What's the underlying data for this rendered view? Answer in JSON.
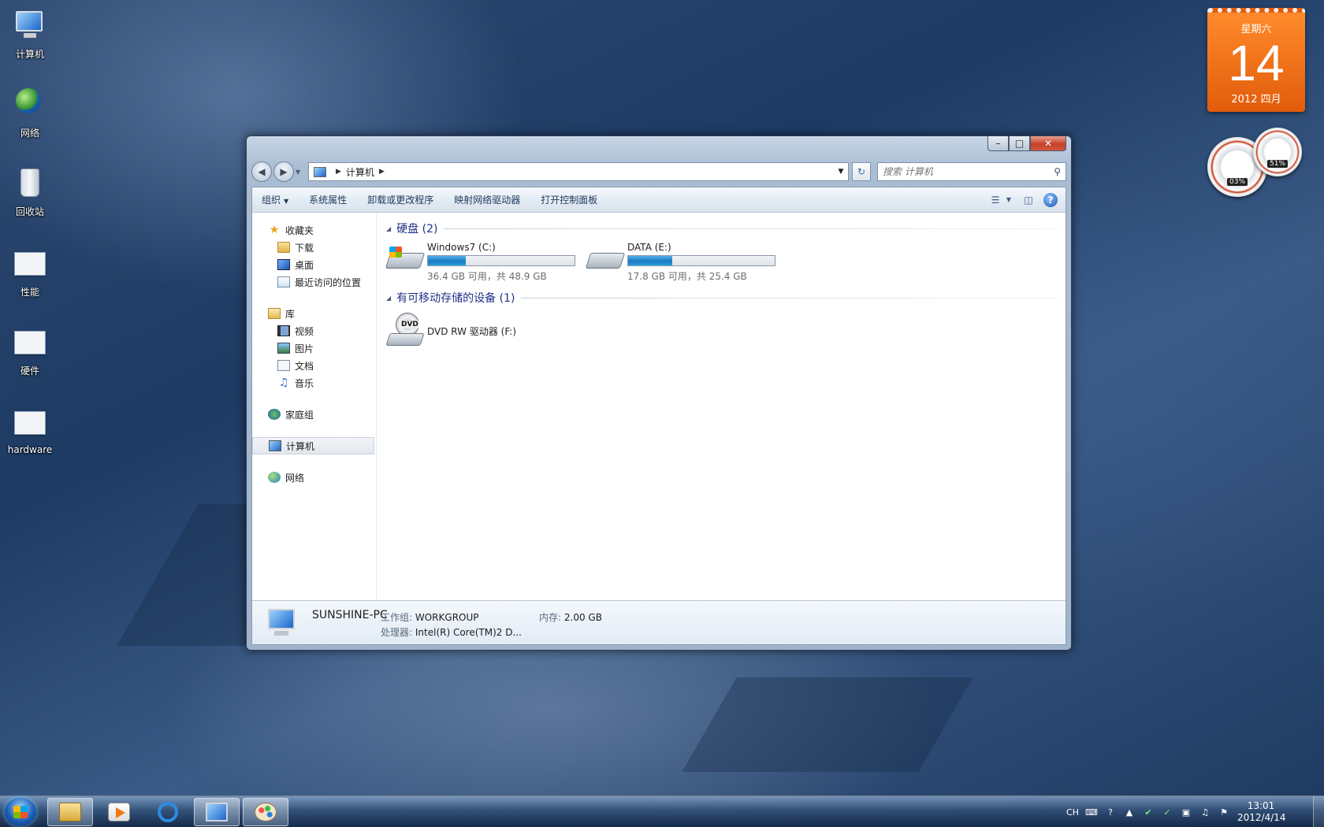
{
  "desktop": {
    "icons": [
      {
        "label": "计算机"
      },
      {
        "label": "网络"
      },
      {
        "label": "回收站"
      },
      {
        "label": "性能"
      },
      {
        "label": "硬件"
      },
      {
        "label": "hardware"
      }
    ]
  },
  "calendar": {
    "weekday": "星期六",
    "day": "14",
    "year_month": "2012 四月"
  },
  "meters": {
    "cpu": "03%",
    "memory": "51%"
  },
  "window": {
    "address": {
      "location": "计算机"
    },
    "search": {
      "placeholder": "搜索 计算机"
    },
    "commands": {
      "organize": "组织",
      "system_properties": "系统属性",
      "uninstall": "卸载或更改程序",
      "map_drive": "映射网络驱动器",
      "control_panel": "打开控制面板"
    },
    "nav": {
      "favorites": "收藏夹",
      "downloads": "下载",
      "desktop": "桌面",
      "recent": "最近访问的位置",
      "libraries": "库",
      "videos": "视频",
      "pictures": "图片",
      "documents": "文档",
      "music": "音乐",
      "homegroup": "家庭组",
      "computer": "计算机",
      "network": "网络"
    },
    "groups": {
      "hard_disks": "硬盘 (2)",
      "removable": "有可移动存储的设备 (1)"
    },
    "drives": [
      {
        "name": "Windows7 (C:)",
        "free": "36.4 GB 可用，共 48.9 GB",
        "used_fraction": 0.256
      },
      {
        "name": "DATA (E:)",
        "free": "17.8 GB 可用，共 25.4 GB",
        "used_fraction": 0.3
      }
    ],
    "dvd": {
      "name": "DVD RW 驱动器 (F:)",
      "label": "DVD"
    },
    "details": {
      "pc_name": "SUNSHINE-PC",
      "workgroup_label": "工作组:",
      "workgroup_value": "WORKGROUP",
      "memory_label": "内存:",
      "memory_value": "2.00 GB",
      "processor_label": "处理器:",
      "processor_value": "Intel(R) Core(TM)2 D..."
    }
  },
  "taskbar": {
    "tray_lang": "CH",
    "time": "13:01",
    "date": "2012/4/14"
  }
}
